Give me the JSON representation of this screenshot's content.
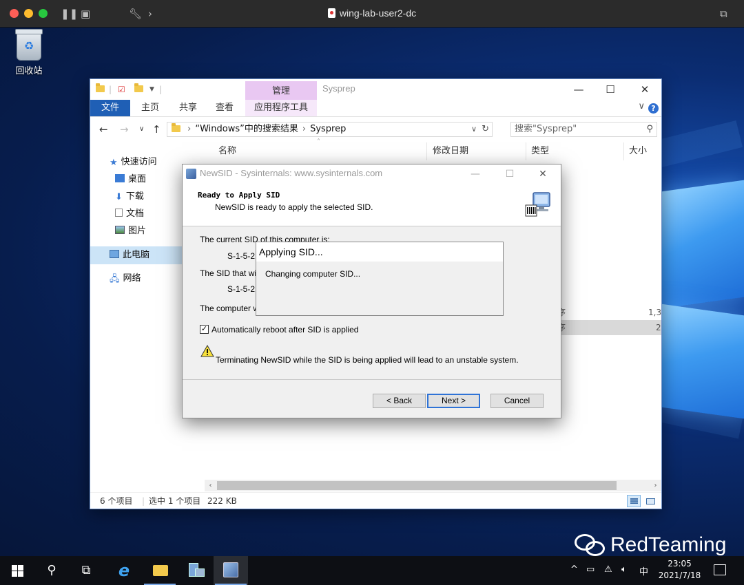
{
  "mac": {
    "title": "wing-lab-user2-dc"
  },
  "desktop": {
    "recycle_bin_label": "回收站",
    "watermark": "RedTeaming"
  },
  "explorer": {
    "title": "Sysprep",
    "manage_tab": "管理",
    "ribbon_tabs": [
      "文件",
      "主页",
      "共享",
      "查看",
      "应用程序工具"
    ],
    "address": {
      "part1": "“Windows”中的搜索结果",
      "part2": "Sysprep"
    },
    "search_placeholder": "搜索\"Sysprep\"",
    "sidebar": [
      {
        "label": "快速访问",
        "icon": "star-icon"
      },
      {
        "label": "桌面",
        "icon": "desktop-icon"
      },
      {
        "label": "下载",
        "icon": "download-icon"
      },
      {
        "label": "文档",
        "icon": "document-icon"
      },
      {
        "label": "图片",
        "icon": "pictures-icon"
      },
      {
        "label": "此电脑",
        "icon": "computer-icon"
      },
      {
        "label": "网络",
        "icon": "network-icon"
      }
    ],
    "columns": [
      "名称",
      "修改日期",
      "类型",
      "大小"
    ],
    "rows": [
      {
        "type": "序",
        "size": "1,3"
      },
      {
        "type": "序",
        "size": "2"
      }
    ],
    "status": {
      "count": "6 个项目",
      "selected": "选中 1 个项目",
      "size": "222 KB"
    }
  },
  "dialog": {
    "title": "NewSID - Sysinternals: www.sysinternals.com",
    "heading": "Ready to Apply SID",
    "subheading": "NewSID is ready to apply the selected SID.",
    "current_sid_label": "The current SID of this computer is:",
    "current_sid_value": "S-1-5-21",
    "new_sid_label": "The SID that will",
    "new_sid_value": "S-1-5-21",
    "computer_line": "The computer wi",
    "checkbox_label": "Automatically reboot after SID is applied",
    "checkbox_checked": true,
    "warning": "Terminating NewSID while the SID is being applied will lead to an unstable system.",
    "buttons": {
      "back": "< Back",
      "next": "Next >",
      "cancel": "Cancel"
    }
  },
  "progress_popup": {
    "title": "Applying SID...",
    "message": "Changing computer SID..."
  },
  "taskbar": {
    "ime": "中",
    "time": "23:05",
    "date": "2021/7/18"
  }
}
